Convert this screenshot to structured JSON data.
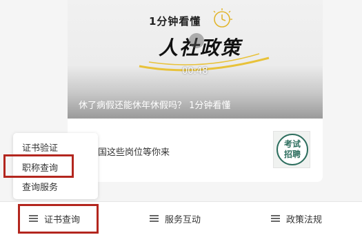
{
  "video": {
    "kicker": "1分钟看懂",
    "headline": "人社政策",
    "time": "00:48",
    "title": "休了病假还能休年休假吗？ 1分钟看懂"
  },
  "news": {
    "text": "国这些岗位等你来",
    "thumb_line1": "考试",
    "thumb_line2": "招聘"
  },
  "popup_menu": {
    "items": [
      "证书验证",
      "职称查询",
      "查询服务"
    ],
    "highlighted_index": 1
  },
  "tabbar": {
    "tabs": [
      {
        "label": "证书查询",
        "icon": "menu-icon",
        "highlighted": true
      },
      {
        "label": "服务互动",
        "icon": "menu-icon"
      },
      {
        "label": "政策法规",
        "icon": "menu-icon"
      }
    ]
  },
  "colors": {
    "highlight": "#b3261e",
    "stamp": "#2d6e5e"
  }
}
